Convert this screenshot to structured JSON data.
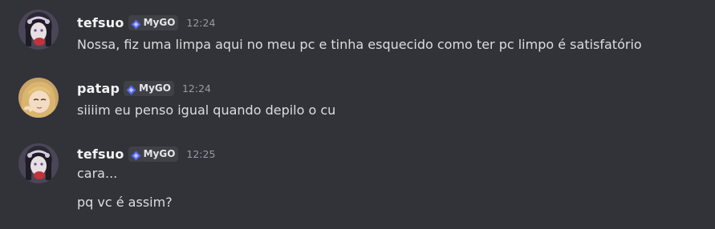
{
  "messages": [
    {
      "username": "tefsuo",
      "tag": "MyGO",
      "tag_icon": "clan-diamond-icon",
      "time": "12:24",
      "avatar": "tefsuo-avatar",
      "lines": [
        "Nossa, fiz uma limpa aqui no meu pc e tinha esquecido como ter pc limpo é satisfatório"
      ]
    },
    {
      "username": "patap",
      "tag": "MyGO",
      "tag_icon": "clan-diamond-icon",
      "time": "12:24",
      "avatar": "patap-avatar",
      "lines": [
        "siiiim eu penso igual quando depilo o cu"
      ]
    },
    {
      "username": "tefsuo",
      "tag": "MyGO",
      "tag_icon": "clan-diamond-icon",
      "time": "12:25",
      "avatar": "tefsuo-avatar",
      "lines": [
        "cara...",
        "pq vc é assim?"
      ]
    }
  ],
  "colors": {
    "background": "#313338",
    "username": "#f2f3f5",
    "message_text": "#dbdee1",
    "timestamp": "#949ba4",
    "tag_background": "#3f4147",
    "tag_icon": "#5865f2"
  }
}
